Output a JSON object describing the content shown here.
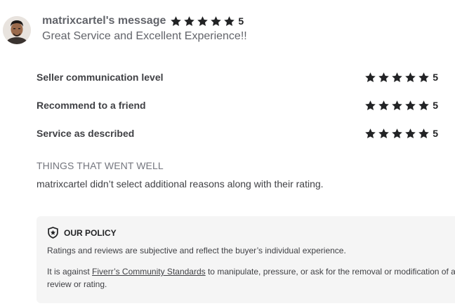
{
  "review": {
    "reviewer_message": "matrixcartel's message",
    "score": "5",
    "comment": "Great Service and Excellent Experience!!",
    "stars": 5
  },
  "ratings": [
    {
      "label": "Seller communication level",
      "score": "5"
    },
    {
      "label": "Recommend to a friend",
      "score": "5"
    },
    {
      "label": "Service as described",
      "score": "5"
    }
  ],
  "things_went_well": {
    "title": "THINGS THAT WENT WELL",
    "text": "matrixcartel didn’t select additional reasons along with their rating."
  },
  "policy": {
    "title": "OUR POLICY",
    "line1": "Ratings and reviews are subjective and reflect the buyer’s individual experience.",
    "line2_prefix": "It is against ",
    "link_text": "Fiverr’s Community Standards",
    "line2_suffix": " to manipulate, pressure, or ask for the removal or modification of a",
    "line3": "review or rating."
  },
  "icons": {
    "star": "star-icon",
    "shield": "shield-star-icon"
  },
  "colors": {
    "star": "#222325",
    "policy_bg": "#f5f5f5"
  }
}
